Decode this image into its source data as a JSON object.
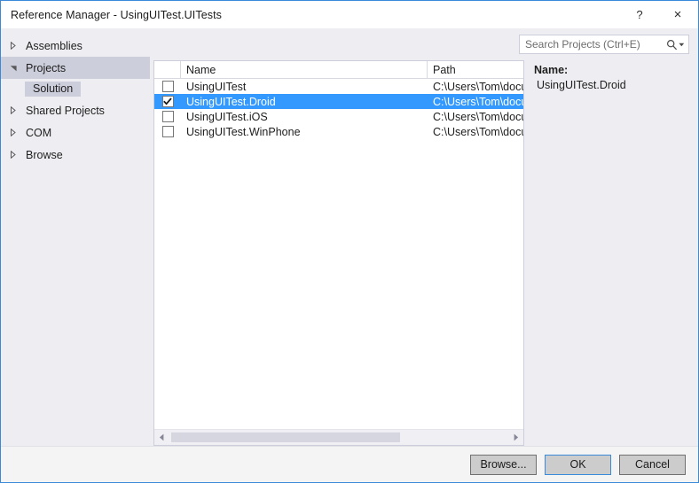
{
  "window": {
    "title": "Reference Manager - UsingUITest.UITests",
    "help_label": "?",
    "close_label": "×"
  },
  "sidebar": {
    "items": [
      {
        "label": "Assemblies",
        "expanded": false,
        "selected": false
      },
      {
        "label": "Projects",
        "expanded": true,
        "selected": true
      }
    ],
    "sub_item": {
      "label": "Solution",
      "selected": true
    },
    "items_after": [
      {
        "label": "Shared Projects",
        "expanded": false,
        "selected": false
      },
      {
        "label": "COM",
        "expanded": false,
        "selected": false
      },
      {
        "label": "Browse",
        "expanded": false,
        "selected": false
      }
    ]
  },
  "search": {
    "placeholder": "Search Projects (Ctrl+E)",
    "value": "",
    "icon": "search-icon",
    "caret": "▾"
  },
  "list": {
    "columns": {
      "check": "",
      "name": "Name",
      "path": "Path"
    },
    "rows": [
      {
        "checked": false,
        "name": "UsingUITest",
        "path": "C:\\Users\\Tom\\document",
        "selected": false
      },
      {
        "checked": true,
        "name": "UsingUITest.Droid",
        "path": "C:\\Users\\Tom\\document",
        "selected": true
      },
      {
        "checked": false,
        "name": "UsingUITest.iOS",
        "path": "C:\\Users\\Tom\\document",
        "selected": false
      },
      {
        "checked": false,
        "name": "UsingUITest.WinPhone",
        "path": "C:\\Users\\Tom\\document",
        "selected": false
      }
    ]
  },
  "detail": {
    "name_label": "Name:",
    "name_value": "UsingUITest.Droid"
  },
  "footer": {
    "browse_label": "Browse...",
    "ok_label": "OK",
    "cancel_label": "Cancel"
  },
  "colors": {
    "accent": "#3b8ad9",
    "selection": "#3399ff",
    "sidebar_bg": "#eeeef2",
    "nav_selected": "#cccedb"
  }
}
